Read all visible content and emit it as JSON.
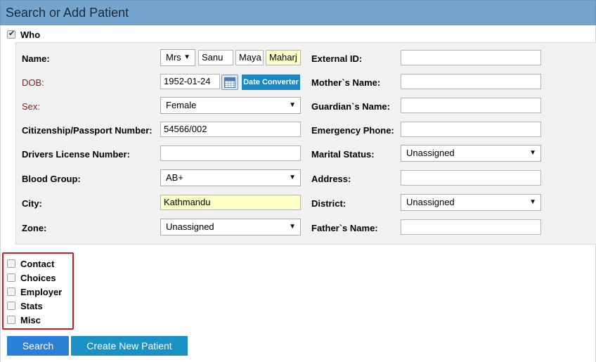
{
  "header": {
    "title": "Search or Add Patient"
  },
  "who": {
    "label": "Who",
    "checked": true
  },
  "form": {
    "name": {
      "label": "Name:",
      "title": "Mrs",
      "first": "Sanu",
      "middle": "Maya",
      "last": "Maharj"
    },
    "dob": {
      "label": "DOB:",
      "value": "1952-01-24",
      "converter_label": "Date Converter"
    },
    "sex": {
      "label": "Sex:",
      "value": "Female"
    },
    "citizenship": {
      "label": "Citizenship/Passport Number:",
      "value": "54566/002"
    },
    "drivers_license": {
      "label": "Drivers License Number:",
      "value": ""
    },
    "blood_group": {
      "label": "Blood Group:",
      "value": "AB+"
    },
    "city": {
      "label": "City:",
      "value": "Kathmandu"
    },
    "zone": {
      "label": "Zone:",
      "value": "Unassigned"
    },
    "external_id": {
      "label": "External ID:",
      "value": ""
    },
    "mothers_name": {
      "label": "Mother`s Name:",
      "value": ""
    },
    "guardians_name": {
      "label": "Guardian`s Name:",
      "value": ""
    },
    "emergency_phone": {
      "label": "Emergency Phone:",
      "value": ""
    },
    "marital_status": {
      "label": "Marital Status:",
      "value": "Unassigned"
    },
    "address": {
      "label": "Address:",
      "value": ""
    },
    "district": {
      "label": "District:",
      "value": "Unassigned"
    },
    "fathers_name": {
      "label": "Father`s Name:",
      "value": ""
    }
  },
  "sections": [
    {
      "label": "Contact",
      "checked": false
    },
    {
      "label": "Choices",
      "checked": false
    },
    {
      "label": "Employer",
      "checked": false
    },
    {
      "label": "Stats",
      "checked": false
    },
    {
      "label": "Misc",
      "checked": false
    }
  ],
  "buttons": {
    "search": "Search",
    "create": "Create New Patient"
  },
  "colors": {
    "header_bg": "#75a5cf",
    "highlight_field": "#ffffc8",
    "required_label": "#8b1a1a",
    "annotation_box": "#e0161d",
    "search_button": "#2c7fd6",
    "create_button": "#1a91c4"
  }
}
